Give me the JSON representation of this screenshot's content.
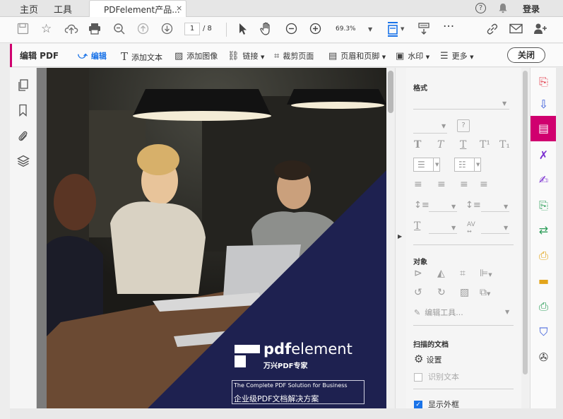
{
  "menu": {
    "home": "主页",
    "tools": "工具",
    "help_icon": "help-circle-icon",
    "bell_icon": "bell-icon",
    "login": "登录"
  },
  "tab": {
    "title": "PDFelement产品...",
    "close": "×"
  },
  "toolbar": {
    "page_current": "1",
    "page_total": "/ 8",
    "zoom": "69.3%"
  },
  "editbar": {
    "title": "编辑 PDF",
    "edit": "编辑",
    "add_text": "添加文本",
    "add_image": "添加图像",
    "link": "链接",
    "crop": "裁剪页面",
    "header_footer": "页眉和页脚",
    "watermark": "水印",
    "more": "更多",
    "close": "关闭"
  },
  "document": {
    "brand_pdf": "pdf",
    "brand_element": "element",
    "brand_cn": "万兴PDF专家",
    "tagline_en": "The Complete PDF Solution for Business",
    "tagline_cn": "企业级PDF文档解决方案"
  },
  "panel": {
    "format_heading": "格式",
    "object_heading": "对象",
    "edit_tool": "编辑工具...",
    "scan_heading": "扫描的文档",
    "settings": "设置",
    "recognize_text": "识别文本",
    "show_border": "显示外框",
    "show_border_checked": true,
    "recognize_checked": false
  },
  "colors": {
    "accent": "#d0006f",
    "navy": "#1e2150",
    "checkbox": "#1a73e8"
  }
}
